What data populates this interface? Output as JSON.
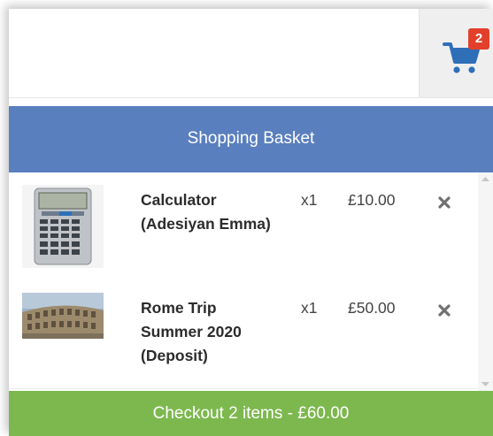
{
  "cart": {
    "badge_count": "2",
    "icon": "shopping-cart-icon",
    "icon_color": "#2f6fb8",
    "badge_color": "#e2402b"
  },
  "basket": {
    "title": "Shopping Basket",
    "header_color": "#5a7fbe",
    "items": [
      {
        "name": "Calculator (Adesiyan Emma)",
        "qty": "x1",
        "price": "£10.00",
        "thumbnail": "calculator-image",
        "remove_icon": "close-icon"
      },
      {
        "name": "Rome Trip Summer 2020 (Deposit)",
        "qty": "x1",
        "price": "£50.00",
        "thumbnail": "colosseum-image",
        "remove_icon": "close-icon"
      }
    ]
  },
  "checkout": {
    "label": "Checkout 2 items - £60.00",
    "color": "#7db84f"
  }
}
